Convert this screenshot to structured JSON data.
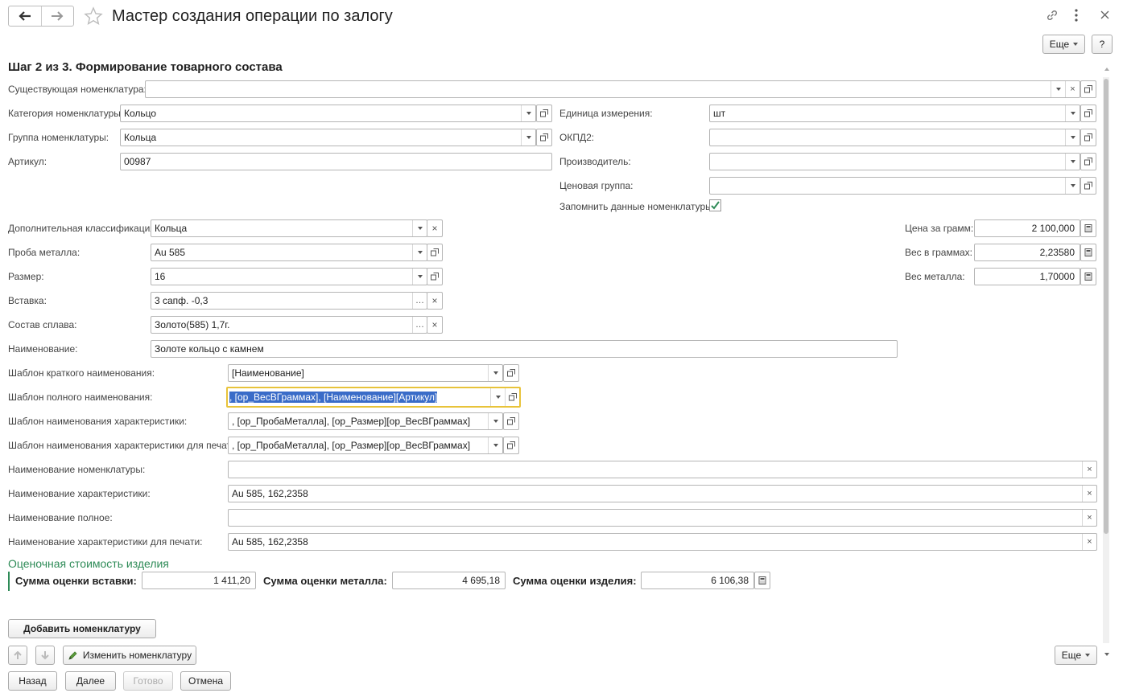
{
  "window": {
    "title": "Мастер создания операции по залогу",
    "more": "Еще",
    "help": "?"
  },
  "step": "Шаг 2 из 3. Формирование товарного состава",
  "labels": {
    "existing": "Существующая номенклатура:",
    "category": "Категория номенклатуры:",
    "group": "Группа номенклатуры:",
    "article": "Артикул:",
    "unit": "Единица измерения:",
    "okpd": "ОКПД2:",
    "maker": "Производитель:",
    "price_group": "Ценовая группа:",
    "remember": "Запомнить данные номенклатуры:",
    "extra_class": "Дополнительная классификация:",
    "probe": "Проба металла:",
    "size": "Размер:",
    "insert": "Вставка:",
    "alloy": "Состав сплава:",
    "name": "Наименование:",
    "tpl_short": "Шаблон краткого наименования:",
    "tpl_full": "Шаблон полного наименования:",
    "tpl_char": "Шаблон наименования характеристики:",
    "tpl_char_print": "Шаблон наименования характеристики для печати:",
    "nom_name": "Наименование номенклатуры:",
    "char_name": "Наименование характеристики:",
    "full_name": "Наименование полное:",
    "char_print": "Наименование характеристики для печати:",
    "price_gram": "Цена за грамм:",
    "weight": "Вес в граммах:",
    "metal_weight": "Вес металла:"
  },
  "values": {
    "existing": "",
    "category": "Кольцо",
    "group": "Кольца",
    "article": "00987",
    "unit": "шт",
    "okpd": "",
    "maker": "",
    "price_group": "",
    "extra_class": "Кольца",
    "probe": "Au 585",
    "size": "16",
    "insert": "3 сапф. -0,3",
    "alloy": "Золото(585) 1,7г.",
    "name": "Золоте кольцо с камнем",
    "tpl_short": "[Наименование]",
    "tpl_full": ", [ор_ВесВГраммах], [Наименование][Артикул]",
    "tpl_char": ", [ор_ПробаМеталла], [ор_Размер][ор_ВесВГраммах]",
    "tpl_char_print": ", [ор_ПробаМеталла], [ор_Размер][ор_ВесВГраммах]",
    "nom_name": "",
    "char_name": "Au 585, 162,2358",
    "full_name": "",
    "char_print": "Au 585, 162,2358",
    "price_gram": "2 100,000",
    "weight": "2,23580",
    "metal_weight": "1,70000"
  },
  "estimate": {
    "title": "Оценочная стоимость изделия",
    "insert_label": "Сумма оценки вставки:",
    "insert_value": "1 411,20",
    "metal_label": "Сумма оценки металла:",
    "metal_value": "4 695,18",
    "item_label": "Сумма оценки изделия:",
    "item_value": "6 106,38"
  },
  "buttons": {
    "add": "Добавить номенклатуру",
    "edit": "Изменить номенклатуру",
    "more": "Еще",
    "back": "Назад",
    "next": "Далее",
    "done": "Готово",
    "cancel": "Отмена"
  },
  "colors": {
    "accent": "#2e8b57",
    "focus": "#e8c33a",
    "selection": "#3a6cc8",
    "check": "#2e8b57"
  }
}
